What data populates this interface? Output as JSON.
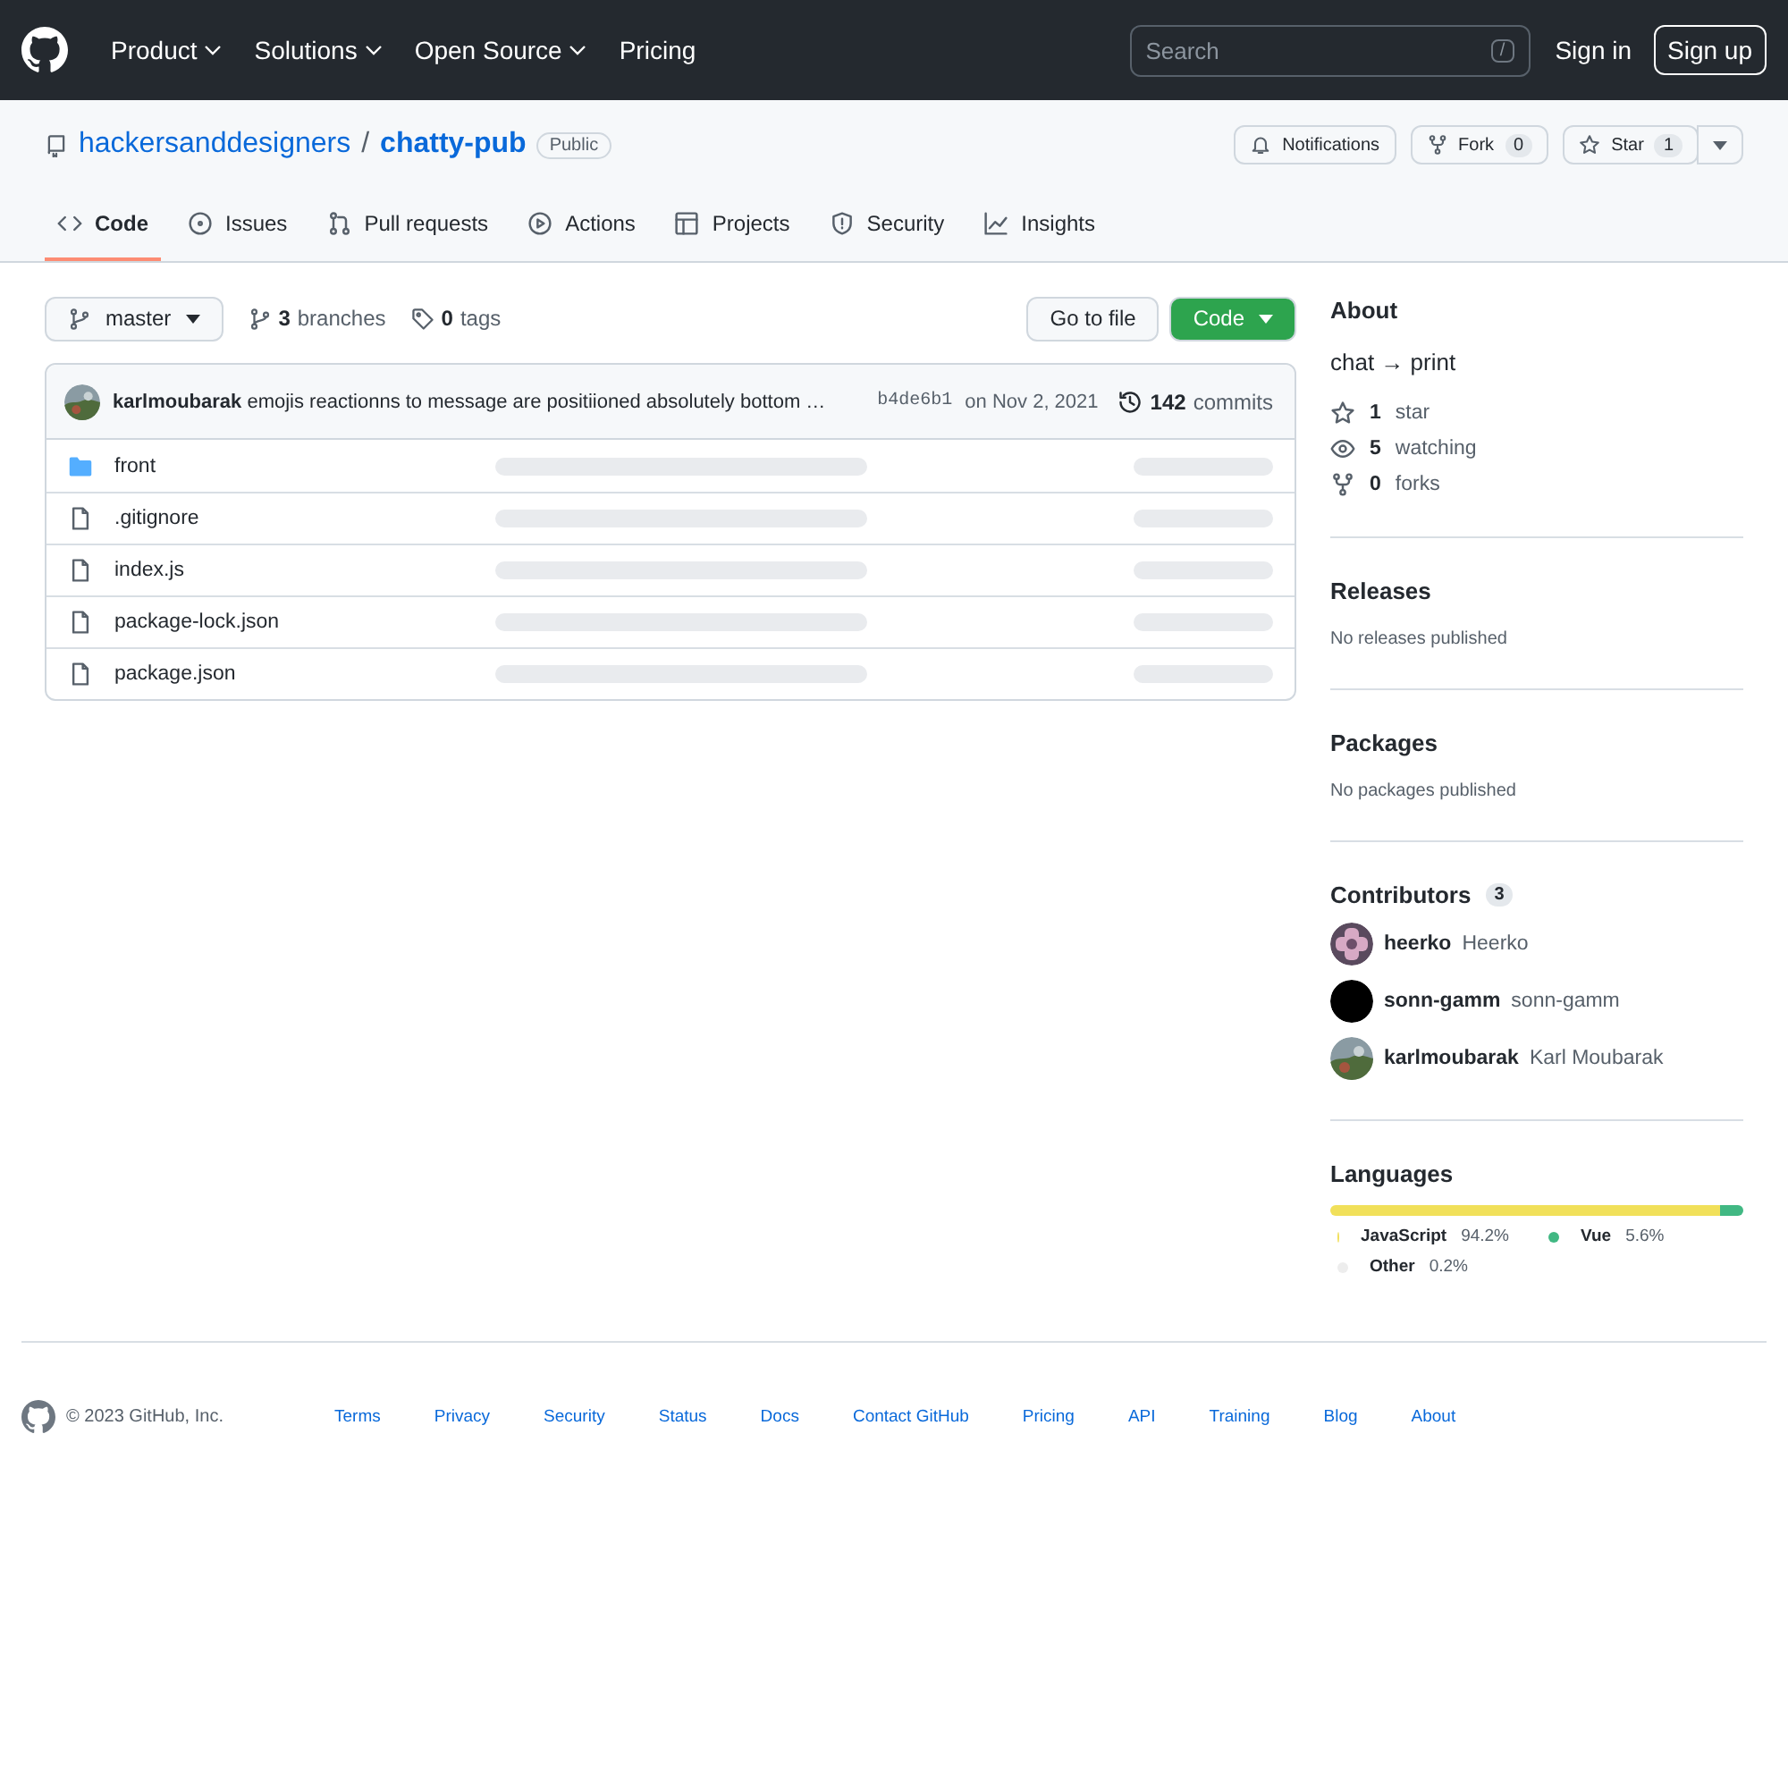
{
  "topbar": {
    "nav": [
      {
        "label": "Product",
        "dropdown": true
      },
      {
        "label": "Solutions",
        "dropdown": true
      },
      {
        "label": "Open Source",
        "dropdown": true
      },
      {
        "label": "Pricing",
        "dropdown": false
      }
    ],
    "search": {
      "placeholder": "Search",
      "shortcut": "/"
    },
    "sign_in": "Sign in",
    "sign_up": "Sign up"
  },
  "repo": {
    "owner": "hackersanddesigners",
    "separator": "/",
    "name": "chatty-pub",
    "visibility": "Public",
    "actions": [
      {
        "kind": "notify",
        "label": "Notifications"
      },
      {
        "kind": "fork",
        "label": "Fork",
        "count": "0"
      },
      {
        "kind": "star",
        "label": "Star",
        "count": "1"
      }
    ]
  },
  "tabs": [
    {
      "label": "Code",
      "selected": true
    },
    {
      "label": "Issues",
      "selected": false
    },
    {
      "label": "Pull requests",
      "selected": false
    },
    {
      "label": "Actions",
      "selected": false
    },
    {
      "label": "Projects",
      "selected": false
    },
    {
      "label": "Security",
      "selected": false
    },
    {
      "label": "Insights",
      "selected": false
    }
  ],
  "branch_bar": {
    "branch": "master",
    "branches_count": "3",
    "branches_label": "branches",
    "tags_count": "0",
    "tags_label": "tags",
    "go_to_file": "Go to file",
    "code_button": "Code"
  },
  "commit": {
    "author": "karlmoubarak",
    "message": "emojis reactionns to message are positiioned absolutely bottom …",
    "sha": "b4de6b1",
    "date": "on Nov 2, 2021",
    "commits_count": "142",
    "commits_label": "commits"
  },
  "files": [
    {
      "kind": "folder",
      "name": "front"
    },
    {
      "kind": "file",
      "name": ".gitignore"
    },
    {
      "kind": "file",
      "name": "index.js"
    },
    {
      "kind": "file",
      "name": "package-lock.json"
    },
    {
      "kind": "file",
      "name": "package.json"
    }
  ],
  "about": {
    "title": "About",
    "description": "chat → print",
    "stats": [
      {
        "count": "1",
        "label": "star"
      },
      {
        "count": "5",
        "label": "watching"
      },
      {
        "count": "0",
        "label": "forks"
      }
    ]
  },
  "releases": {
    "title": "Releases",
    "note": "No releases published"
  },
  "packages": {
    "title": "Packages",
    "note": "No packages published"
  },
  "contributors": {
    "title": "Contributors",
    "count": "3",
    "people": [
      {
        "login": "heerko",
        "name": "Heerko"
      },
      {
        "login": "sonn-gamm",
        "name": "sonn-gamm"
      },
      {
        "login": "karlmoubarak",
        "name": "Karl Moubarak"
      }
    ]
  },
  "languages": {
    "title": "Languages",
    "items": [
      {
        "name": "JavaScript",
        "percent": "94.2%",
        "level": 0.942,
        "color": "#f1e05a"
      },
      {
        "name": "Vue",
        "percent": "5.6%",
        "level": 0.056,
        "color": "#41b883"
      },
      {
        "name": "Other",
        "percent": "0.2%",
        "level": 0.002,
        "color": "#ededed"
      }
    ]
  },
  "footer": {
    "copyright": "© 2023 GitHub, Inc.",
    "links": [
      "Terms",
      "Privacy",
      "Security",
      "Status",
      "Docs",
      "Contact GitHub",
      "Pricing",
      "API",
      "Training",
      "Blog",
      "About"
    ]
  }
}
